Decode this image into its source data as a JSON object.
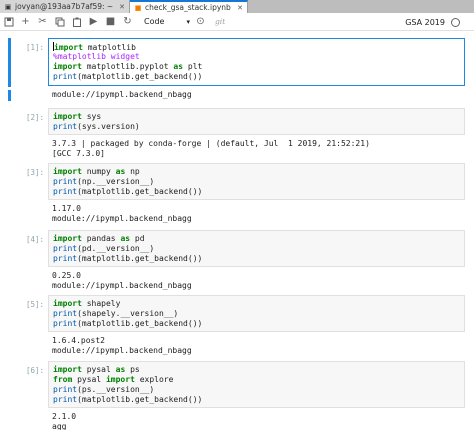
{
  "tabs": [
    {
      "label": "jovyan@193aa7b7af59: ~",
      "icon": "terminal-icon",
      "active": false
    },
    {
      "label": "check_gsa_stack.ipynb",
      "icon": "notebook-icon",
      "active": true
    }
  ],
  "toolbar": {
    "cell_type": "Code",
    "git_label": "git",
    "kernel_name": "GSA 2019",
    "icons": [
      "save-icon",
      "add-icon",
      "cut-icon",
      "copy-icon",
      "paste-icon",
      "run-icon",
      "stop-icon",
      "restart-icon",
      "cell-type-icon"
    ]
  },
  "cells": [
    {
      "prompt": "[1]:",
      "input": [
        [
          {
            "t": "import",
            "c": "kw"
          },
          {
            "t": " matplotlib"
          }
        ],
        [
          {
            "t": "%matplotlib widget",
            "c": "mg"
          }
        ],
        [
          {
            "t": "import",
            "c": "kw"
          },
          {
            "t": " matplotlib.pyplot "
          },
          {
            "t": "as",
            "c": "kw"
          },
          {
            "t": " plt"
          }
        ],
        [
          {
            "t": "print",
            "c": "fn"
          },
          {
            "t": "(matplotlib.get_backend())"
          }
        ]
      ],
      "output": [
        "module://ipympl.backend_nbagg"
      ]
    },
    {
      "prompt": "[2]:",
      "input": [
        [
          {
            "t": "import",
            "c": "kw"
          },
          {
            "t": " sys"
          }
        ],
        [
          {
            "t": "print",
            "c": "fn"
          },
          {
            "t": "(sys.version)"
          }
        ]
      ],
      "output": [
        "3.7.3 | packaged by conda-forge | (default, Jul  1 2019, 21:52:21)",
        "[GCC 7.3.0]"
      ]
    },
    {
      "prompt": "[3]:",
      "input": [
        [
          {
            "t": "import",
            "c": "kw"
          },
          {
            "t": " numpy "
          },
          {
            "t": "as",
            "c": "kw"
          },
          {
            "t": " np"
          }
        ],
        [
          {
            "t": "print",
            "c": "fn"
          },
          {
            "t": "(np.__version__)"
          }
        ],
        [
          {
            "t": "print",
            "c": "fn"
          },
          {
            "t": "(matplotlib.get_backend())"
          }
        ]
      ],
      "output": [
        "1.17.0",
        "module://ipympl.backend_nbagg"
      ]
    },
    {
      "prompt": "[4]:",
      "input": [
        [
          {
            "t": "import",
            "c": "kw"
          },
          {
            "t": " pandas "
          },
          {
            "t": "as",
            "c": "kw"
          },
          {
            "t": " pd"
          }
        ],
        [
          {
            "t": "print",
            "c": "fn"
          },
          {
            "t": "(pd.__version__)"
          }
        ],
        [
          {
            "t": "print",
            "c": "fn"
          },
          {
            "t": "(matplotlib.get_backend())"
          }
        ]
      ],
      "output": [
        "0.25.0",
        "module://ipympl.backend_nbagg"
      ]
    },
    {
      "prompt": "[5]:",
      "input": [
        [
          {
            "t": "import",
            "c": "kw"
          },
          {
            "t": " shapely"
          }
        ],
        [
          {
            "t": "print",
            "c": "fn"
          },
          {
            "t": "(shapely.__version__)"
          }
        ],
        [
          {
            "t": "print",
            "c": "fn"
          },
          {
            "t": "(matplotlib.get_backend())"
          }
        ]
      ],
      "output": [
        "1.6.4.post2",
        "module://ipympl.backend_nbagg"
      ]
    },
    {
      "prompt": "[6]:",
      "input": [
        [
          {
            "t": "import",
            "c": "kw"
          },
          {
            "t": " pysal "
          },
          {
            "t": "as",
            "c": "kw"
          },
          {
            "t": " ps"
          }
        ],
        [
          {
            "t": "from",
            "c": "kw"
          },
          {
            "t": " pysal "
          },
          {
            "t": "import",
            "c": "kw"
          },
          {
            "t": " explore"
          }
        ],
        [
          {
            "t": "print",
            "c": "fn"
          },
          {
            "t": "(ps.__version__)"
          }
        ],
        [
          {
            "t": "print",
            "c": "fn"
          },
          {
            "t": "(matplotlib.get_backend())"
          }
        ]
      ],
      "output": [
        "2.1.0",
        "agg"
      ]
    }
  ],
  "colors": {
    "accent": "#1e88e5",
    "keyword": "#008000",
    "magic": "#aa22ff",
    "builtin": "#0055aa",
    "prompt": "#90a4ae"
  }
}
